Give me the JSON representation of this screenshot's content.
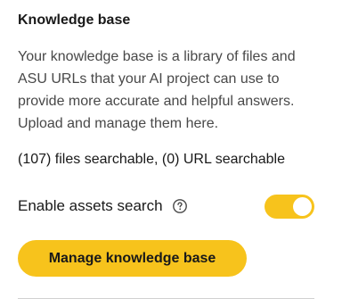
{
  "section": {
    "title": "Knowledge base",
    "description": "Your knowledge base is a library of files and ASU URLs that your AI project can use to provide more accurate and helpful answers. Upload and manage them here.",
    "counts": "(107) files searchable, (0) URL searchable"
  },
  "assets_search": {
    "label": "Enable assets search",
    "help_icon": "question-circle-icon",
    "enabled": true
  },
  "actions": {
    "manage_label": "Manage knowledge base"
  },
  "colors": {
    "accent": "#f7c31c",
    "text": "#191919",
    "muted_text": "#484848",
    "divider": "#d0d0d0"
  }
}
